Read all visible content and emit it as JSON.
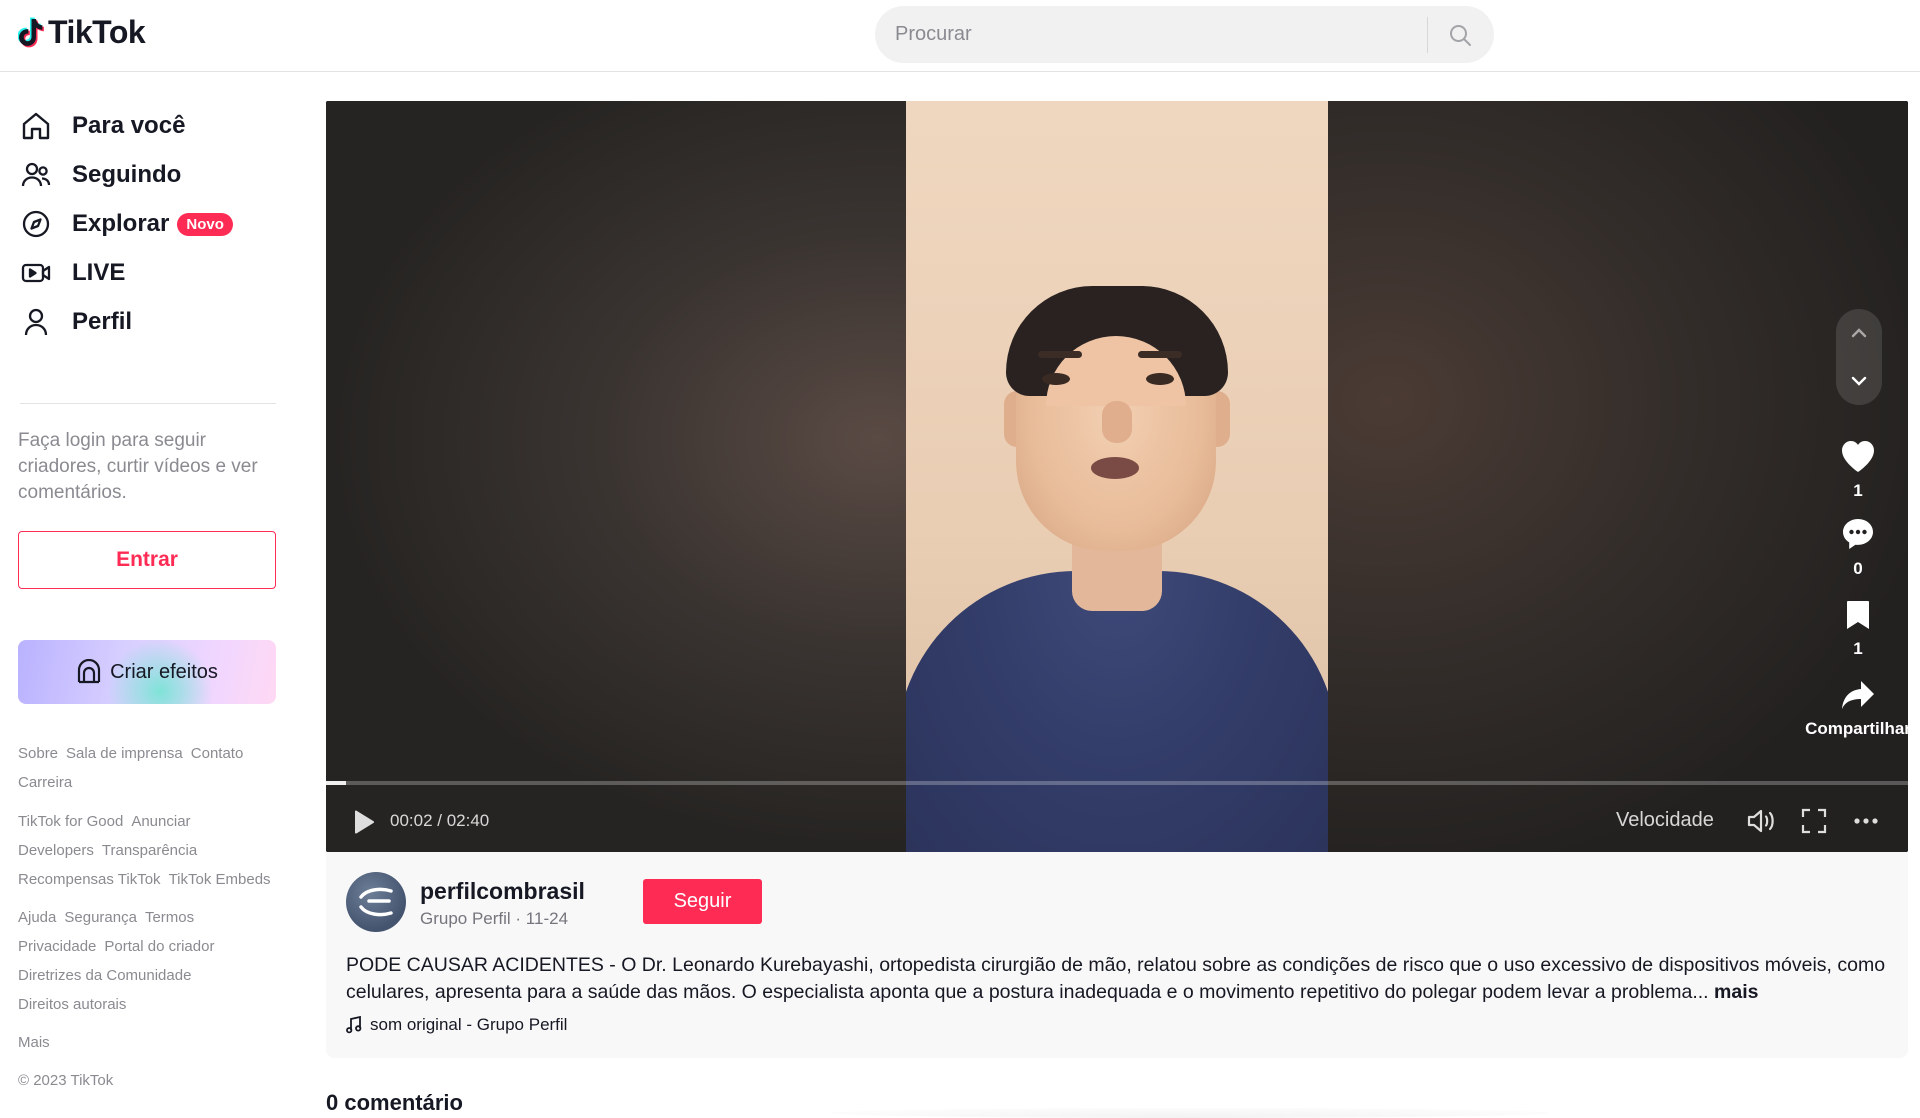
{
  "header": {
    "brand": "TikTok",
    "search_placeholder": "Procurar"
  },
  "sidebar": {
    "nav": [
      {
        "label": "Para você",
        "icon": "home-icon"
      },
      {
        "label": "Seguindo",
        "icon": "users-icon"
      },
      {
        "label": "Explorar",
        "icon": "compass-icon",
        "badge": "Novo"
      },
      {
        "label": "LIVE",
        "icon": "live-camera-icon"
      },
      {
        "label": "Perfil",
        "icon": "person-icon"
      }
    ],
    "login_prompt": "Faça login para seguir criadores, curtir vídeos e ver comentários.",
    "login_button": "Entrar",
    "effects_button": "Criar efeitos",
    "footer_links": {
      "row1": [
        "Sobre",
        "Sala de imprensa",
        "Contato"
      ],
      "row2": [
        "Carreira"
      ],
      "row3": [
        "TikTok for Good",
        "Anunciar"
      ],
      "row4": [
        "Developers",
        "Transparência"
      ],
      "row5": [
        "Recompensas TikTok",
        "TikTok Embeds"
      ],
      "row6": [
        "Ajuda",
        "Segurança",
        "Termos"
      ],
      "row7": [
        "Privacidade",
        "Portal do criador"
      ],
      "row8": [
        "Diretrizes da Comunidade"
      ],
      "row9": [
        "Direitos autorais"
      ],
      "row10": [
        "Mais"
      ]
    },
    "copyright": "© 2023 TikTok"
  },
  "player": {
    "current_time": "00:02",
    "duration": "02:40",
    "time_display": "00:02 / 02:40",
    "progress_fraction": 0.0125,
    "speed_label": "Velocidade",
    "likes": "1",
    "comments": "0",
    "saves": "1",
    "share_label": "Compartilhar"
  },
  "post": {
    "author": "perfilcombrasil",
    "author_sub": "Grupo Perfil · 11-24",
    "follow_button": "Seguir",
    "description": "PODE CAUSAR ACIDENTES - O Dr. Leonardo Kurebayashi, ortopedista cirurgião de mão, relatou sobre as condições de risco que o uso excessivo de dispositivos móveis, como celulares, apresenta para a saúde das mãos. O especialista aponta que a postura inadequada e o movimento repetitivo do polegar podem levar a problema...",
    "more_label": "mais",
    "sound": "som original - Grupo Perfil"
  },
  "comments": {
    "title": "0 comentário"
  },
  "colors": {
    "accent": "#fe2c55",
    "text": "#161823",
    "muted": "#8a8b91"
  }
}
